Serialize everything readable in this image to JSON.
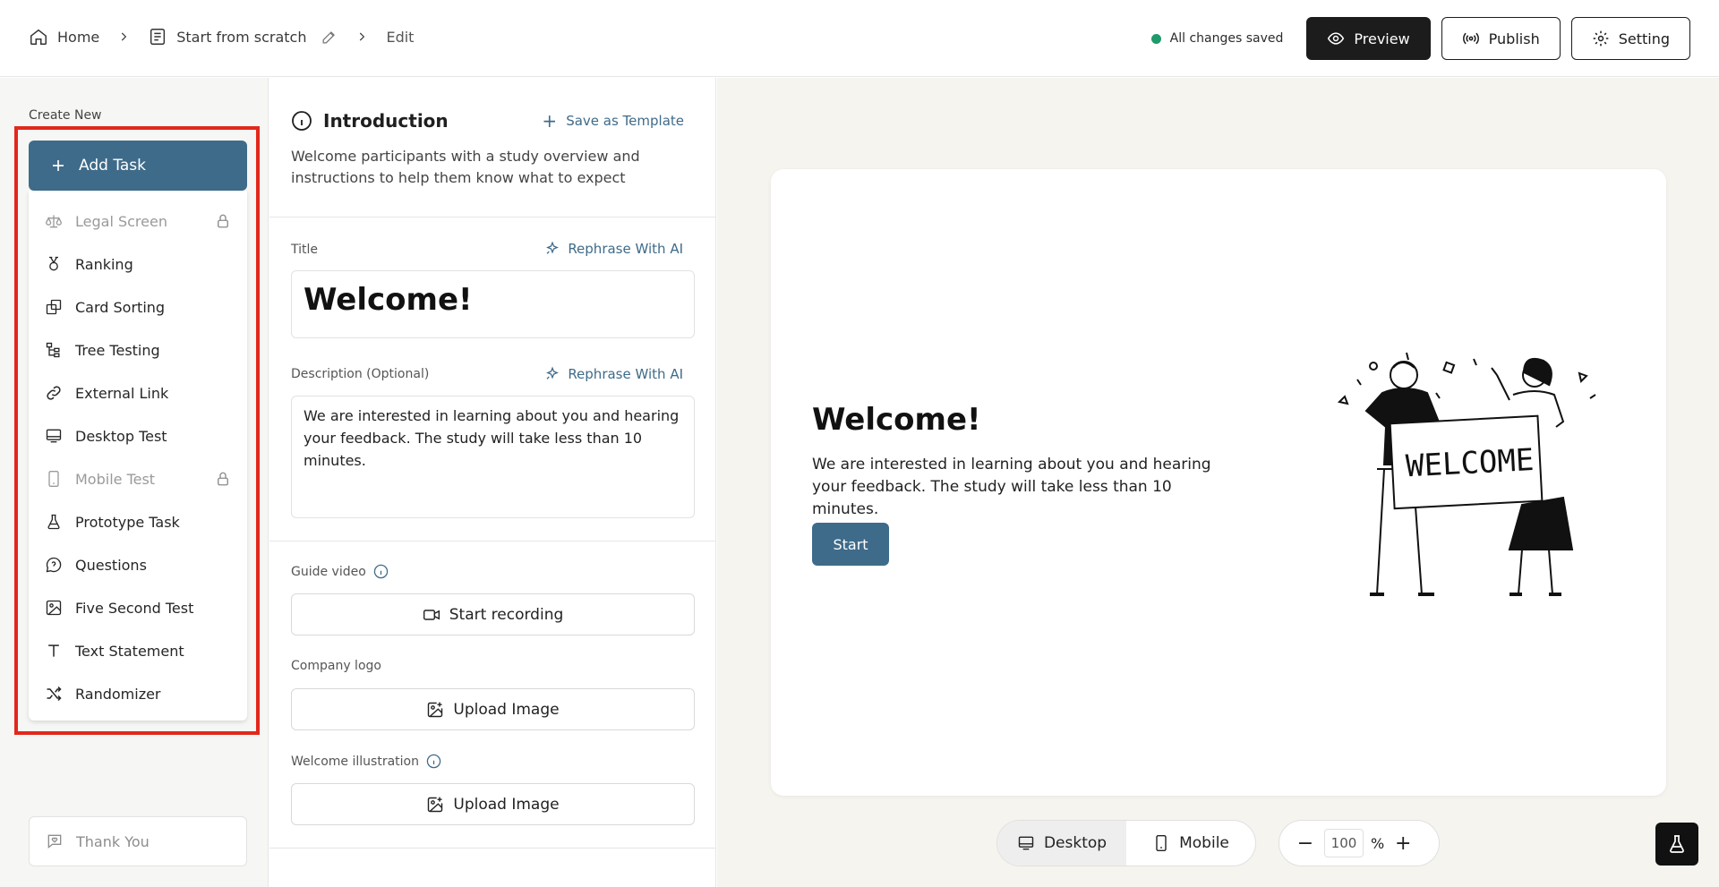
{
  "breadcrumb": {
    "home": "Home",
    "study": "Start from scratch",
    "current": "Edit"
  },
  "status": {
    "saved_text": "All changes saved",
    "dot_color": "#1f9a6b"
  },
  "header_buttons": {
    "preview": "Preview",
    "publish": "Publish",
    "setting": "Setting"
  },
  "sidebar": {
    "section_label": "Create New",
    "add_task": "Add Task",
    "tasks": [
      {
        "label": "Legal Screen",
        "icon": "scale-icon",
        "locked": true
      },
      {
        "label": "Ranking",
        "icon": "medal-icon",
        "locked": false
      },
      {
        "label": "Card Sorting",
        "icon": "cards-icon",
        "locked": false
      },
      {
        "label": "Tree Testing",
        "icon": "tree-icon",
        "locked": false
      },
      {
        "label": "External Link",
        "icon": "link-icon",
        "locked": false
      },
      {
        "label": "Desktop Test",
        "icon": "monitor-icon",
        "locked": false
      },
      {
        "label": "Mobile Test",
        "icon": "phone-icon",
        "locked": true
      },
      {
        "label": "Prototype Task",
        "icon": "flask-icon",
        "locked": false
      },
      {
        "label": "Questions",
        "icon": "question-bubble-icon",
        "locked": false
      },
      {
        "label": "Five Second Test",
        "icon": "image-icon",
        "locked": false
      },
      {
        "label": "Text Statement",
        "icon": "text-icon",
        "locked": false
      },
      {
        "label": "Randomizer",
        "icon": "shuffle-icon",
        "locked": false
      }
    ],
    "thank_you": "Thank You"
  },
  "editor": {
    "section_title": "Introduction",
    "save_template": "Save as Template",
    "section_desc": "Welcome participants with a study overview and instructions to help them know what to expect",
    "title_label": "Title",
    "rephrase": "Rephrase With AI",
    "title_value": "Welcome!",
    "desc_label": "Description (Optional)",
    "desc_value": "We are interested in learning about you and hearing your feedback. The study will take less than 10 minutes.",
    "guide_video_label": "Guide video",
    "start_recording": "Start recording",
    "company_logo_label": "Company logo",
    "upload_image": "Upload Image",
    "welcome_illustration_label": "Welcome illustration"
  },
  "preview": {
    "title": "Welcome!",
    "desc": "We are interested in learning about you and hearing your feedback. The study will take less than 10 minutes.",
    "start": "Start",
    "sign_text": "WELCOME"
  },
  "bottom_bar": {
    "desktop": "Desktop",
    "mobile": "Mobile",
    "zoom_value": "100",
    "zoom_unit": "%",
    "zoom_minus": "−",
    "zoom_plus": "+"
  },
  "colors": {
    "accent": "#3f6b8a",
    "highlight": "#e3281b",
    "dark": "#1c1c1c"
  }
}
